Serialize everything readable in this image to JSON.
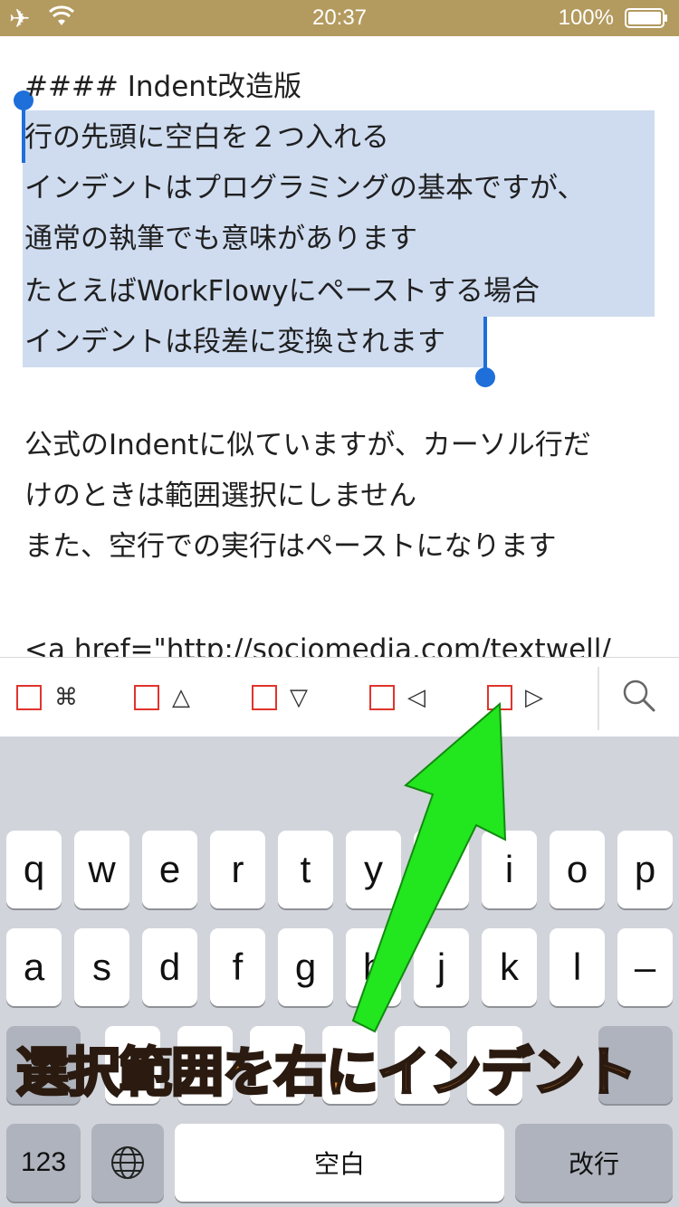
{
  "status_bar": {
    "time": "20:37",
    "battery": "100%",
    "airplane_icon": "airplane-icon",
    "wifi_icon": "wifi-icon",
    "battery_icon": "battery-icon"
  },
  "editor": {
    "lines": [
      "#### Indent改造版",
      "行の先頭に空白を２つ入れる",
      "インデントはプログラミングの基本ですが、",
      "通常の執筆でも意味があります",
      "たとえばWorkFlowyにペーストする場合",
      "インデントは段差に変換されます",
      "",
      "公式のIndentに似ていますが、カーソル行だ",
      "けのときは範囲選択にしません",
      "また、空行での実行はペーストになります",
      "",
      "<a href=\"http://sociomedia.com/textwell/"
    ],
    "selection_color": "#cfdcf0",
    "caret_color": "#1e6fd9"
  },
  "accessory_bar": {
    "buttons": [
      {
        "glyph": "⌘",
        "name": "command"
      },
      {
        "glyph": "△",
        "name": "up"
      },
      {
        "glyph": "▽",
        "name": "down"
      },
      {
        "glyph": "◁",
        "name": "left"
      },
      {
        "glyph": "▷",
        "name": "right"
      }
    ],
    "search_icon": "search-icon"
  },
  "keyboard": {
    "row1": [
      "q",
      "w",
      "e",
      "r",
      "t",
      "y",
      "u",
      "i",
      "o",
      "p"
    ],
    "row2": [
      "a",
      "s",
      "d",
      "f",
      "g",
      "h",
      "j",
      "k",
      "l",
      "–"
    ],
    "numbers_label": "123",
    "globe_icon": "globe-icon",
    "space_label": "空白",
    "return_label": "改行"
  },
  "annotation": {
    "text": "選択範囲を右にインデント",
    "arrow_color": "#22e61e",
    "text_color": "#f08a24"
  }
}
